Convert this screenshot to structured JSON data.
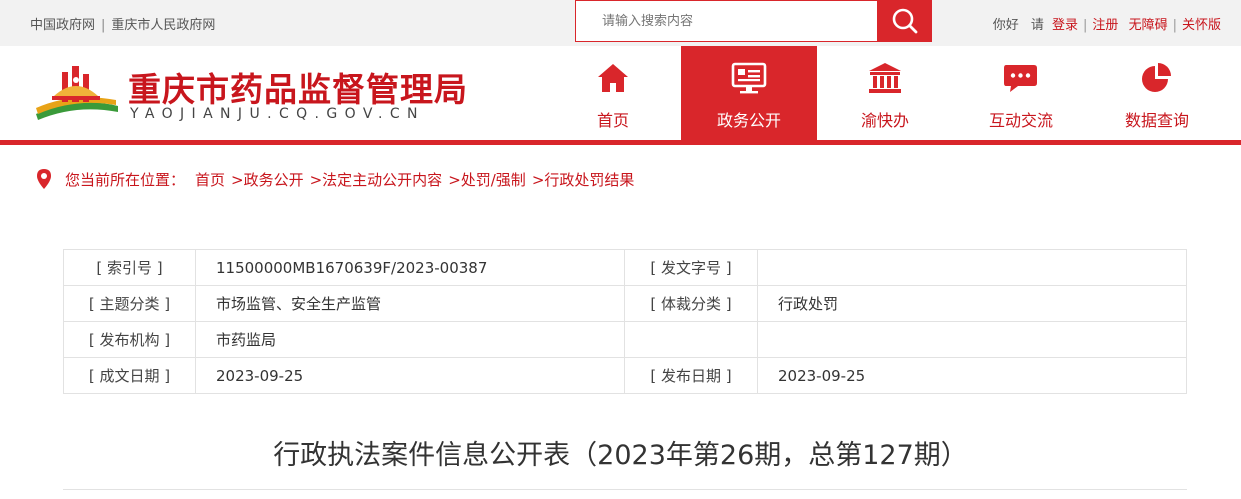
{
  "topbar": {
    "links": [
      "中国政府网",
      "重庆市人民政府网"
    ],
    "search_placeholder": "请输入搜索内容",
    "greeting": "你好",
    "please": "请",
    "login": "登录",
    "register": "注册",
    "accessibility": "无障碍",
    "elderly": "关怀版"
  },
  "header": {
    "title": "重庆市药品监督管理局",
    "domain": "YAOJIANJU.CQ.GOV.CN",
    "nav": [
      {
        "label": "首页",
        "icon": "home-icon",
        "active": false
      },
      {
        "label": "政务公开",
        "icon": "screen-icon",
        "active": true
      },
      {
        "label": "渝快办",
        "icon": "building-icon",
        "active": false
      },
      {
        "label": "互动交流",
        "icon": "chat-icon",
        "active": false
      },
      {
        "label": "数据查询",
        "icon": "pie-chart-icon",
        "active": false
      }
    ]
  },
  "breadcrumb": {
    "prefix": "您当前所在位置：",
    "items": [
      "首页",
      ">政务公开",
      ">法定主动公开内容",
      ">处罚/强制",
      ">行政处罚结果"
    ]
  },
  "info": {
    "rows": [
      {
        "k1": "[ 索引号 ]",
        "v1": "11500000MB1670639F/2023-00387",
        "k2": "[ 发文字号 ]",
        "v2": ""
      },
      {
        "k1": "[ 主题分类 ]",
        "v1": "市场监管、安全生产监管",
        "k2": "[ 体裁分类 ]",
        "v2": "行政处罚"
      },
      {
        "k1": "[ 发布机构 ]",
        "v1": "市药监局",
        "k2": "",
        "v2": ""
      },
      {
        "k1": "[ 成文日期 ]",
        "v1": "2023-09-25",
        "k2": "[ 发布日期 ]",
        "v2": "2023-09-25"
      }
    ]
  },
  "document": {
    "title": "行政执法案件信息公开表（2023年第26期，总第127期）"
  },
  "colors": {
    "brand_red": "#d9262b",
    "text_red": "#c8161d",
    "topbar_bg": "#f2f2f2"
  }
}
